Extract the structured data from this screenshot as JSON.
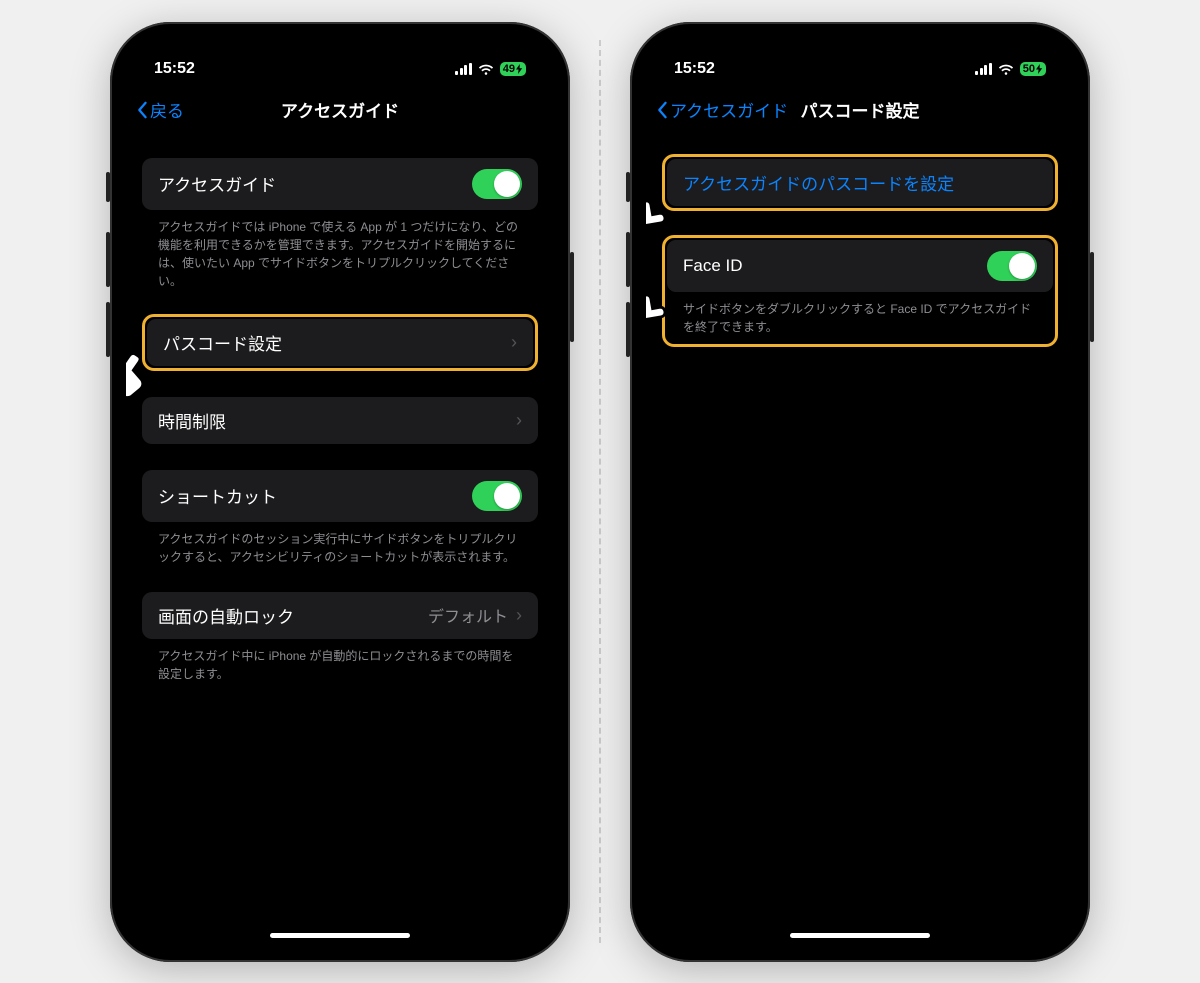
{
  "left": {
    "status": {
      "time": "15:52",
      "battery": "49"
    },
    "nav": {
      "back": "戻る",
      "title": "アクセスガイド"
    },
    "rows": {
      "guided_access": {
        "label": "アクセスガイド",
        "toggle_on": true
      },
      "guided_access_footer": "アクセスガイドでは iPhone で使える App が 1 つだけになり、どの機能を利用できるかを管理できます。アクセスガイドを開始するには、使いたい App でサイドボタンをトリプルクリックしてください。",
      "passcode_settings": {
        "label": "パスコード設定"
      },
      "time_limits": {
        "label": "時間制限"
      },
      "shortcut": {
        "label": "ショートカット",
        "toggle_on": true
      },
      "shortcut_footer": "アクセスガイドのセッション実行中にサイドボタンをトリプルクリックすると、アクセシビリティのショートカットが表示されます。",
      "auto_lock": {
        "label": "画面の自動ロック",
        "value": "デフォルト"
      },
      "auto_lock_footer": "アクセスガイド中に iPhone が自動的にロックされるまでの時間を設定します。"
    }
  },
  "right": {
    "status": {
      "time": "15:52",
      "battery": "50"
    },
    "nav": {
      "back": "アクセスガイド",
      "title": "パスコード設定"
    },
    "rows": {
      "set_passcode": {
        "label": "アクセスガイドのパスコードを設定"
      },
      "face_id": {
        "label": "Face ID",
        "toggle_on": true
      },
      "face_id_footer": "サイドボタンをダブルクリックすると Face ID でアクセスガイドを終了できます。"
    }
  }
}
